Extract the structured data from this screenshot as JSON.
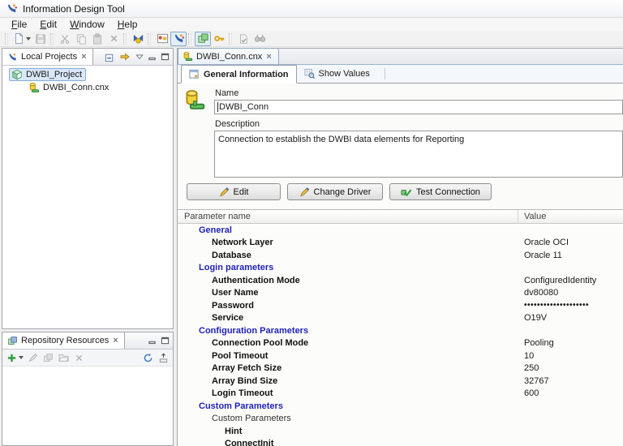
{
  "window": {
    "title": "Information Design Tool"
  },
  "menu": {
    "items": [
      {
        "label": "File"
      },
      {
        "label": "Edit"
      },
      {
        "label": "Window"
      },
      {
        "label": "Help"
      }
    ]
  },
  "toolbar": {
    "icons": [
      "new-document",
      "save",
      "cut",
      "copy",
      "paste",
      "delete",
      "publish-key",
      "welcome",
      "idt-swoosh",
      "insert-resource-cube",
      "security-key",
      "check-integrity",
      "find-binoculars"
    ]
  },
  "panels": {
    "local_projects": {
      "title": "Local Projects",
      "toolbar_icons": [
        "collapse-all",
        "link-with-editor",
        "view-menu",
        "minimize",
        "maximize"
      ],
      "tree": [
        {
          "label": "DWBI_Project",
          "selected": true
        },
        {
          "label": "DWBI_Conn.cnx",
          "selected": false
        }
      ]
    },
    "repository_resources": {
      "title": "Repository Resources",
      "toolbar_icons": [
        "insert-session",
        "insert-session-menu",
        "edit",
        "cube",
        "open",
        "delete",
        "refresh",
        "collapse"
      ]
    }
  },
  "editor": {
    "tab_label": "DWBI_Conn.cnx",
    "tabs": [
      {
        "label": "General Information"
      },
      {
        "label": "Show Values"
      }
    ],
    "fields": {
      "name_label": "Name",
      "name_value": "DWBI_Conn",
      "description_label": "Description",
      "description_value": "Connection to establish the DWBI data elements for Reporting"
    },
    "buttons": [
      {
        "label": "Edit"
      },
      {
        "label": "Change Driver"
      },
      {
        "label": "Test Connection"
      }
    ],
    "table": {
      "columns": [
        "Parameter name",
        "Value"
      ],
      "rows": [
        {
          "label": "General",
          "value": "",
          "kind": "section"
        },
        {
          "label": "Network Layer",
          "value": "Oracle OCI",
          "kind": "param"
        },
        {
          "label": "Database",
          "value": "Oracle 11",
          "kind": "param"
        },
        {
          "label": "Login parameters",
          "value": "",
          "kind": "section"
        },
        {
          "label": "Authentication Mode",
          "value": "ConfiguredIdentity",
          "kind": "param"
        },
        {
          "label": "User Name",
          "value": "dv80080",
          "kind": "param"
        },
        {
          "label": "Password",
          "value": "••••••••••••••••••••",
          "kind": "param-masked"
        },
        {
          "label": "Service",
          "value": "O19V",
          "kind": "param"
        },
        {
          "label": "Configuration Parameters",
          "value": "",
          "kind": "section"
        },
        {
          "label": "Connection Pool Mode",
          "value": "Pooling",
          "kind": "param"
        },
        {
          "label": "Pool Timeout",
          "value": "10",
          "kind": "param"
        },
        {
          "label": "Array Fetch Size",
          "value": "250",
          "kind": "param"
        },
        {
          "label": "Array Bind Size",
          "value": "32767",
          "kind": "param"
        },
        {
          "label": "Login Timeout",
          "value": "600",
          "kind": "param"
        },
        {
          "label": "Custom Parameters",
          "value": "",
          "kind": "section"
        },
        {
          "label": "Custom Parameters",
          "value": "",
          "kind": "group"
        },
        {
          "label": "Hint",
          "value": "",
          "kind": "param-sub"
        },
        {
          "label": "ConnectInit",
          "value": "",
          "kind": "param-sub"
        }
      ]
    }
  },
  "colors": {
    "section_text": "#2222b8",
    "selection_bg": "#d9e7f8",
    "selection_border": "#84acdd",
    "editor_tab_border": "#8ca8c6",
    "connection_yellow": "#f2d23c",
    "connection_green": "#63c063"
  }
}
